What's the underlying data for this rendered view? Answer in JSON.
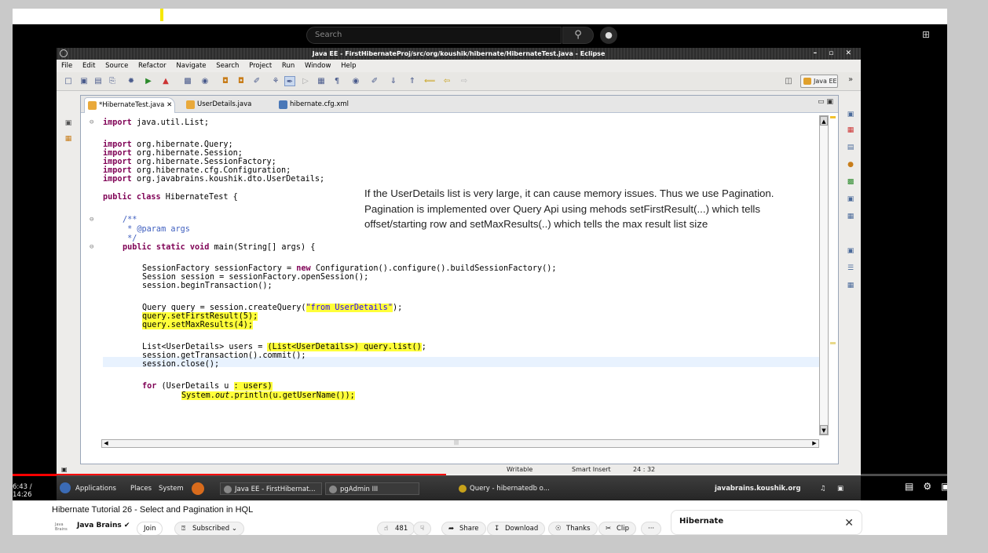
{
  "yt": {
    "search_placeholder": "Search",
    "time": "6:43 / 14:26",
    "video_title": "Hibernate Tutorial 26 - Select and Pagination in HQL",
    "channel_logo": "Java Brains",
    "channel": "Java Brains ✔",
    "join": "Join",
    "subscribed": "Subscribed ⌄",
    "likes": "481",
    "share": "Share",
    "download": "Download",
    "thanks": "Thanks",
    "clip": "Clip",
    "more": "···",
    "playlist_title": "Hibernate",
    "progress_fraction": 0.4637
  },
  "eclipse": {
    "title": "Java EE - FirstHibernateProj/src/org/koushik/hibernate/HibernateTest.java - Eclipse",
    "menu": [
      "File",
      "Edit",
      "Source",
      "Refactor",
      "Navigate",
      "Search",
      "Project",
      "Run",
      "Window",
      "Help"
    ],
    "perspective": "Java EE",
    "tabs": [
      "*HibernateTest.java ✕",
      "UserDetails.java",
      "hibernate.cfg.xml"
    ],
    "status": {
      "writable": "Writable",
      "insert": "Smart Insert",
      "pos": "24 : 32"
    }
  },
  "code": {
    "l1_kw": "import",
    "l1": " java.util.List;",
    "l3_kw": "import",
    "l3": " org.hibernate.Query;",
    "l4_kw": "import",
    "l4": " org.hibernate.Session;",
    "l5_kw": "import",
    "l5": " org.hibernate.SessionFactory;",
    "l6_kw": "import",
    "l6": " org.hibernate.cfg.Configuration;",
    "l7_kw": "import",
    "l7": " org.javabrains.koushik.dto.UserDetails;",
    "l9_kw": "public class",
    "l9": " HibernateTest {",
    "c1": "/**",
    "c2": " * @param args",
    "c3": " */",
    "m_kw": "public static void",
    "m": " main(String[] args) {",
    "s1a": "SessionFactory sessionFactory = ",
    "s1kw": "new",
    "s1b": " Configuration().configure().buildSessionFactory();",
    "s2": "Session session = sessionFactory.openSession();",
    "s3": "session.beginTransaction();",
    "q1a": "Query query = session.createQuery(",
    "q1s": "\"from UserDetails\"",
    "q1b": ");",
    "q2": "query.setFirstResult(5);",
    "q3": "query.setMaxResults(4);",
    "u1a": "List<UserDetails> users = ",
    "u1h": "(List<UserDetails>) query.list()",
    "u1b": ";",
    "u2": "session.getTransaction().commit();",
    "u3": "session.close();",
    "f_kw": "for",
    "f1": " (UserDetails u ",
    "f1h": ": users)",
    "p1": "System.",
    "p1i": "out",
    "p1b": ".println(u.getUserName());"
  },
  "annotation": [
    "If the UserDetails list is very large, it can cause memory issues. Thus we use Pagination.",
    "Pagination is implemented over Query Api using mehods setFirstResult(...) which tells",
    "offset/starting row and setMaxResults(..) which tells the max result list size"
  ],
  "taskbar": {
    "applications": "Applications",
    "places": "Places",
    "system": "System",
    "eclipse": "Java EE - FirstHibernat...",
    "pgadmin": "pgAdmin III",
    "query": "Query - hibernatedb o...",
    "site": "javabrains.koushik.org"
  },
  "colors": {
    "keyword": "#7f0055",
    "comment": "#3f5fbf",
    "string": "#2a00ff",
    "highlight": "#ffff3a",
    "yt_red": "#ff0000"
  }
}
